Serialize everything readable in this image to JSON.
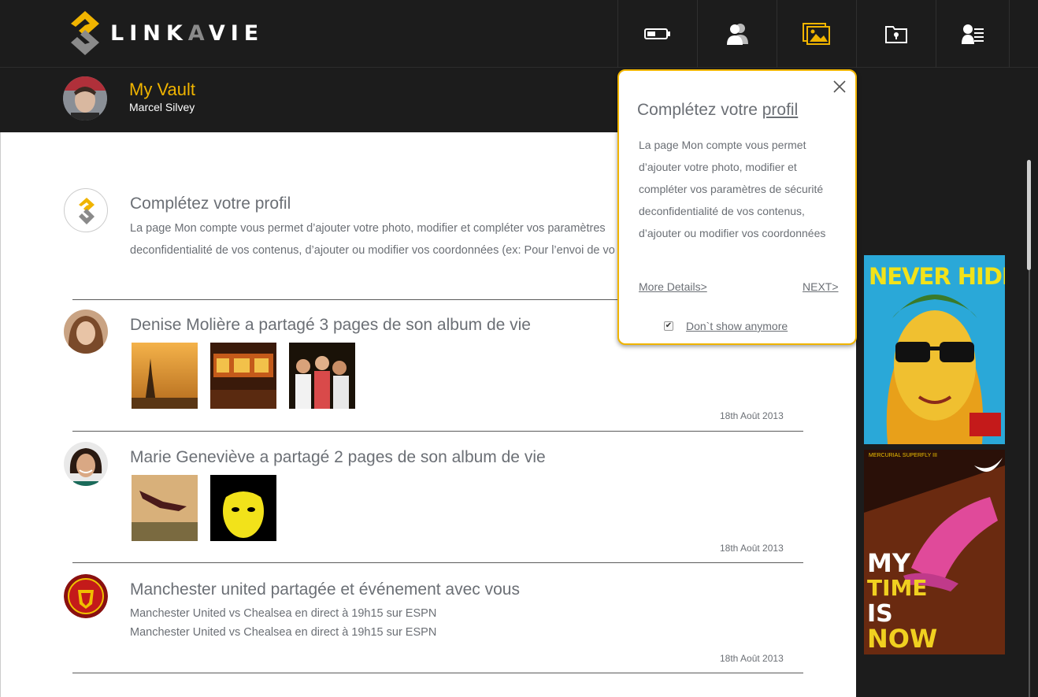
{
  "brand": {
    "logo_text_1": "LINK",
    "logo_text_2": "A",
    "logo_text_3": "VIE",
    "accent": "#f0b400"
  },
  "nav": {
    "items": [
      {
        "icon": "battery-icon"
      },
      {
        "icon": "users-icon"
      },
      {
        "icon": "gallery-icon"
      },
      {
        "icon": "folder-lock-icon"
      },
      {
        "icon": "user-list-icon"
      }
    ]
  },
  "header": {
    "title": "My Vault",
    "user_name": "Marcel Silvey"
  },
  "feed": [
    {
      "title": "Complétez votre profil",
      "line1": "La page Mon compte  vous permet d’ajouter votre photo, modifier et compléter vos paramètres",
      "line2": "deconfidentialité de vos contenus, d’ajouter ou modifier vos coordonnées (ex: Pour l’envoi de vo"
    },
    {
      "title": "Denise Molière a partagé 3 pages de son album de vie",
      "date": "18th Août 2013"
    },
    {
      "title": "Marie Geneviève a partagé 2 pages de son album de vie",
      "date": "18th Août 2013"
    },
    {
      "title": "Manchester united partagée et événement avec vous",
      "line1": "Manchester United vs Chealsea en direct à 19h15 sur ESPN",
      "line2": "Manchester United vs Chealsea en direct à 19h15 sur ESPN",
      "date": "18th Août 2013"
    }
  ],
  "ads": {
    "ad1_text": "NEVER HIDE",
    "ad2_text_1": "MY",
    "ad2_text_2": "TIME",
    "ad2_text_3": "IS",
    "ad2_text_4": "NOW",
    "ad2_caption": "MERCURIAL SUPERFLY III"
  },
  "popup": {
    "title_prefix": "Complétez votre ",
    "title_link": "profil",
    "body": "La page Mon compte  vous permet d’ajouter votre photo, modifier et compléter vos paramètres de sécurité deconfidentialité de vos contenus, d’ajouter ou modifier vos coordonnées",
    "more_details": "More Details>",
    "next": "NEXT>",
    "dont_show": "Don`t show anymore",
    "checkbox_mark": "✔"
  }
}
